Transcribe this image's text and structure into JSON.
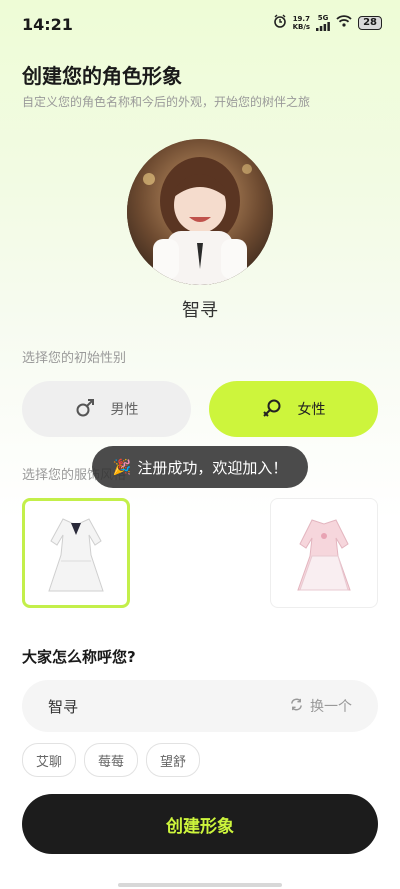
{
  "status_bar": {
    "time": "14:21",
    "net_speed": "19.7",
    "net_unit": "KB/s",
    "signal": "5G",
    "battery": "28"
  },
  "header": {
    "title": "创建您的角色形象",
    "subtitle": "自定义您的角色名称和今后的外观，开始您的树伴之旅"
  },
  "avatar": {
    "name": "智寻"
  },
  "gender": {
    "label": "选择您的初始性别",
    "male_label": "男性",
    "female_label": "女性",
    "selected": "female",
    "male_icon": "male-icon",
    "female_icon": "female-icon"
  },
  "clothing": {
    "label": "选择您的服饰风格"
  },
  "toast": {
    "emoji": "🎉",
    "text": "注册成功，欢迎加入！"
  },
  "nickname": {
    "question": "大家怎么称呼您?",
    "value": "智寻",
    "swap_label": "换一个",
    "suggestions": [
      "艾聊",
      "莓莓",
      "望舒"
    ]
  },
  "create_button": {
    "label": "创建形象"
  },
  "colors": {
    "accent": "#cdf53c",
    "dark": "#1c1c1c"
  }
}
